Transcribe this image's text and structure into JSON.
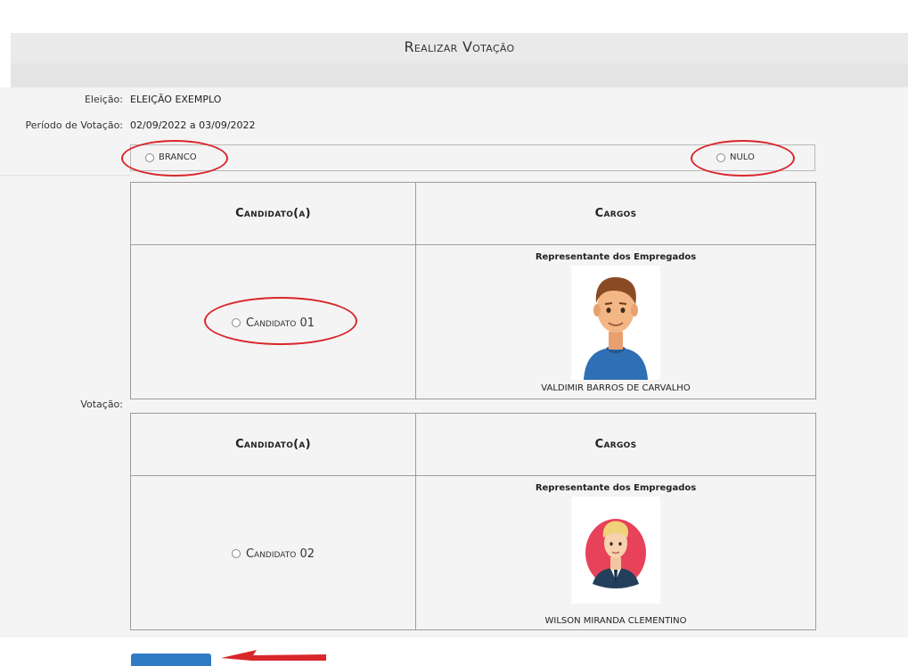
{
  "page": {
    "title": "Realizar Votação"
  },
  "form": {
    "eleicao_label": "Eleição:",
    "eleicao_value": "ELEIÇÃO EXEMPLO",
    "periodo_label": "Período de Votação:",
    "periodo_value": "02/09/2022 a 03/09/2022",
    "votacao_label": "Votação:"
  },
  "options": {
    "branco": "BRANCO",
    "nulo": "NULO"
  },
  "tables": [
    {
      "col_candidato": "Candidato(a)",
      "col_cargos": "Cargos",
      "candidate_option": "Candidato 01",
      "cargo": "Representante dos Empregados",
      "name": "VALDIMIR BARROS DE CARVALHO"
    },
    {
      "col_candidato": "Candidato(a)",
      "col_cargos": "Cargos",
      "candidate_option": "Candidato 02",
      "cargo": "Representante dos Empregados",
      "name": "WILSON MIRANDA CLEMENTINO"
    }
  ],
  "colors": {
    "highlight": "#d9262b",
    "button": "#2f7bc4"
  }
}
